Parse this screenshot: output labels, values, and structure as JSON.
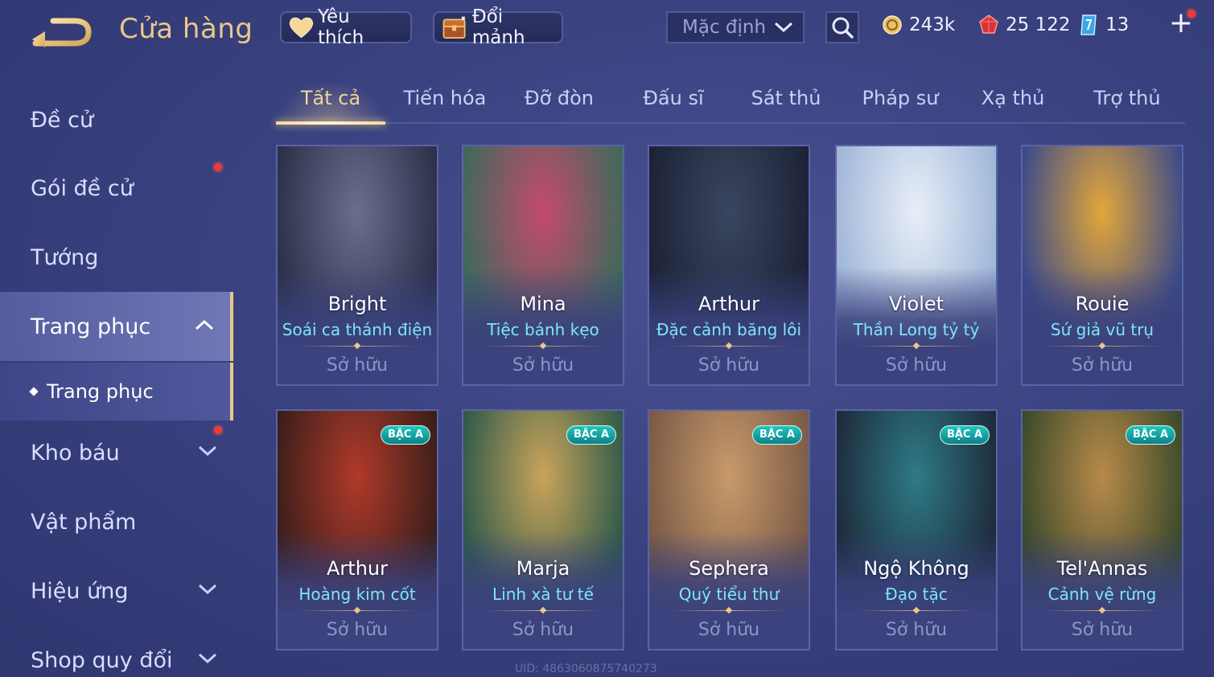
{
  "header": {
    "title": "Cửa hàng",
    "favorites_label": "Yêu thích",
    "shard_exchange_label": "Đổi mảnh",
    "sort_selected": "Mặc định",
    "currencies": {
      "coins": "243k",
      "gems": "25 122",
      "tickets": "13"
    }
  },
  "sidebar": {
    "items": [
      {
        "label": "Đề cử"
      },
      {
        "label": "Gói đề cử"
      },
      {
        "label": "Tướng"
      },
      {
        "label": "Trang phục"
      },
      {
        "label": "Kho báu"
      },
      {
        "label": "Vật phẩm"
      },
      {
        "label": "Hiệu ứng"
      },
      {
        "label": "Shop quy đổi"
      }
    ],
    "sub_item": "Trang phục"
  },
  "tabs": [
    "Tất cả",
    "Tiến hóa",
    "Đỡ đòn",
    "Đấu sĩ",
    "Sát thủ",
    "Pháp sư",
    "Xạ thủ",
    "Trợ thủ"
  ],
  "cards": [
    {
      "hero": "Bright",
      "skin": "Soái ca thánh điện",
      "status": "Sở hữu",
      "badge": "",
      "colors": [
        "#6a6f8f",
        "#2b2f48"
      ]
    },
    {
      "hero": "Mina",
      "skin": "Tiệc bánh kẹo",
      "status": "Sở hữu",
      "badge": "",
      "colors": [
        "#c44a6e",
        "#3d6a5a"
      ]
    },
    {
      "hero": "Arthur",
      "skin": "Đặc cảnh băng lôi",
      "status": "Sở hữu",
      "badge": "",
      "colors": [
        "#3a4660",
        "#1c2236"
      ]
    },
    {
      "hero": "Violet",
      "skin": "Thần Long tỷ tỷ",
      "status": "Sở hữu",
      "badge": "",
      "colors": [
        "#e8eef8",
        "#9fb6d8"
      ]
    },
    {
      "hero": "Rouie",
      "skin": "Sứ giả vũ trụ",
      "status": "Sở hữu",
      "badge": "",
      "colors": [
        "#e2a63a",
        "#3a4a8a"
      ]
    },
    {
      "hero": "Arthur",
      "skin": "Hoàng kim cốt",
      "status": "Sở hữu",
      "badge": "BẬC A",
      "colors": [
        "#b03a2a",
        "#3a1e1a"
      ]
    },
    {
      "hero": "Marja",
      "skin": "Linh xà tư tế",
      "status": "Sở hữu",
      "badge": "BẬC A",
      "colors": [
        "#c9a45a",
        "#2e5a4a"
      ]
    },
    {
      "hero": "Sephera",
      "skin": "Quý tiểu thư",
      "status": "Sở hữu",
      "badge": "BẬC A",
      "colors": [
        "#c79a6a",
        "#7a5a46"
      ]
    },
    {
      "hero": "Ngộ Không",
      "skin": "Đạo tặc",
      "status": "Sở hữu",
      "badge": "BẬC A",
      "colors": [
        "#2e7a86",
        "#1e2a3a"
      ]
    },
    {
      "hero": "Tel'Annas",
      "skin": "Cảnh vệ rừng",
      "status": "Sở hữu",
      "badge": "BẬC A",
      "colors": [
        "#b88a4a",
        "#3a4a2a"
      ]
    }
  ],
  "uid_watermark": "UID: 4863060875740273",
  "accent": "#e9c98a",
  "skin_name_color": "#7ee6f7"
}
